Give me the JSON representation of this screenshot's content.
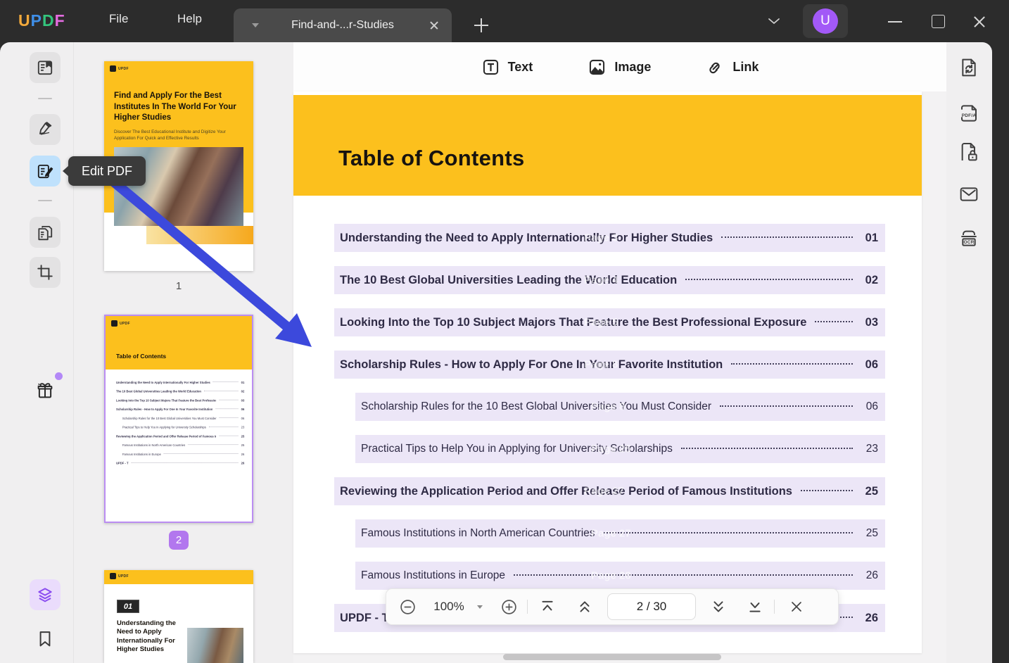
{
  "titlebar": {
    "logo": "UPDF",
    "logo_colors": [
      "#f2a93b",
      "#3f8fe8",
      "#34c57d",
      "#e36ce0"
    ],
    "menu_file": "File",
    "menu_help": "Help",
    "tab_title": "Find-and-...r-Studies",
    "avatar_initial": "U"
  },
  "tooltip": {
    "label": "Edit PDF"
  },
  "thumbnails": {
    "page1": {
      "number": "1",
      "logo": "UPDF",
      "title": "Find and Apply For the Best Institutes In The World For Your Higher Studies",
      "subtitle": "Discover The Best Educational Institute and Digitize Your Application For Quick and Effective Results"
    },
    "page2": {
      "number_badge": "2",
      "logo": "UPDF",
      "heading": "Table of Contents"
    },
    "page3": {
      "logo": "UPDF",
      "chapter_badge": "01",
      "title": "Understanding the Need to Apply Internationally For Higher Studies"
    }
  },
  "edit_toolbar": {
    "text_label": "Text",
    "image_label": "Image",
    "link_label": "Link"
  },
  "document": {
    "heading": "Table of Contents",
    "toc": [
      {
        "label": "Understanding the Need to Apply Internationally For Higher Studies",
        "page": "01",
        "level": 0,
        "ghost": "Page 3"
      },
      {
        "label": "The 10 Best Global Universities Leading the World Education",
        "page": "02",
        "level": 0,
        "ghost": "Page 4"
      },
      {
        "label": "Looking Into the Top 10 Subject Majors That Feature the Best Professional Exposure",
        "page": "03",
        "level": 0,
        "ghost": "Page 5"
      },
      {
        "label": "Scholarship Rules - How to Apply For One In Your Favorite Institution",
        "page": "06",
        "level": 0,
        "ghost": "Page 8"
      },
      {
        "label": "Scholarship Rules for the 10 Best Global Universities You Must Consider",
        "page": "06",
        "level": 1,
        "ghost": "Page 8"
      },
      {
        "label": "Practical Tips to Help You in Applying for University Scholarships",
        "page": "23",
        "level": 1,
        "ghost": "Page 25"
      },
      {
        "label": "Reviewing the Application Period and Offer Release Period of Famous Institutions",
        "page": "25",
        "level": 0,
        "ghost": "Page 27"
      },
      {
        "label": "Famous Institutions in North American Countries",
        "page": "25",
        "level": 1,
        "ghost": "Page 27"
      },
      {
        "label": "Famous Institutions in Europe",
        "page": "26",
        "level": 1,
        "ghost": "Page 28"
      },
      {
        "label": "UPDF - T",
        "page": "26",
        "level": 0,
        "ghost": ""
      }
    ]
  },
  "pager": {
    "zoom_level": "100%",
    "page_display": "2 / 30"
  },
  "right_rail": {
    "pdfa_label": "PDF/A",
    "ocr_label": "OCR"
  },
  "colors": {
    "yellow_banner": "#fcc01d",
    "toc_row_highlight": "#ece6f7",
    "arrow_blue": "#3c49dc",
    "selection_purple": "#b277ee",
    "active_tool_blue": "#bfe1fc",
    "avatar_purple": "#a259f7"
  }
}
